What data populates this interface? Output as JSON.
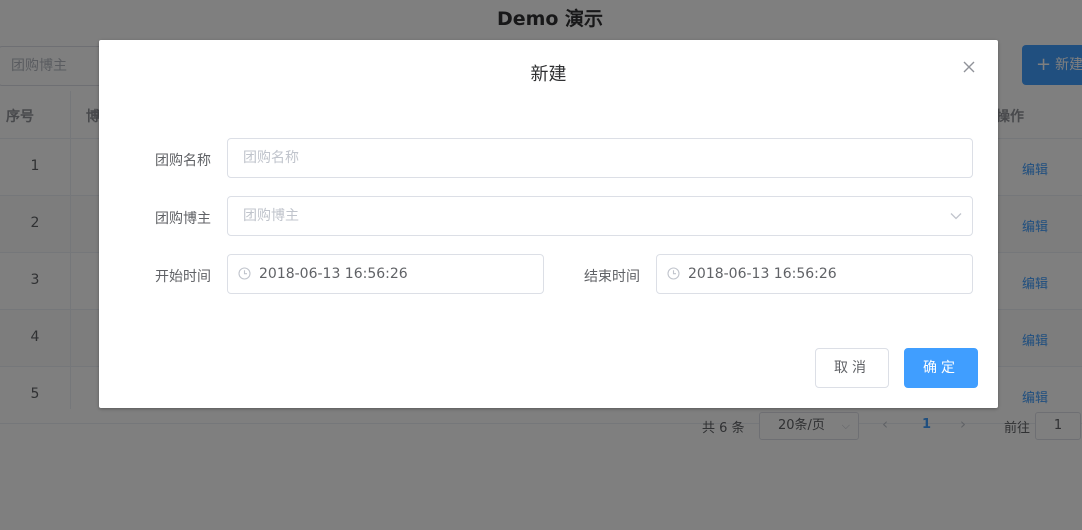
{
  "page": {
    "title": "Demo 演示",
    "search_placeholder": "团购博主",
    "add_button_label": "新建",
    "table": {
      "headers": [
        "序号",
        "博",
        "操作"
      ],
      "rows": [
        {
          "index": "1",
          "action": "编辑"
        },
        {
          "index": "2",
          "action": "编辑"
        },
        {
          "index": "3",
          "action": "编辑"
        },
        {
          "index": "4",
          "action": "编辑"
        },
        {
          "index": "5",
          "action": "编辑"
        }
      ]
    },
    "pagination": {
      "total": "共 6 条",
      "page_size": "20条/页",
      "current_page": "1",
      "goto_label": "前往",
      "goto_value": "1"
    }
  },
  "dialog": {
    "title": "新建",
    "fields": {
      "name": {
        "label": "团购名称",
        "placeholder": "团购名称"
      },
      "blogger": {
        "label": "团购博主",
        "placeholder": "团购博主"
      },
      "start": {
        "label": "开始时间",
        "value": "2018-06-13 16:56:26"
      },
      "end": {
        "label": "结束时间",
        "value": "2018-06-13 16:56:26"
      }
    },
    "cancel_label": "取消",
    "confirm_label": "确定"
  },
  "colors": {
    "primary": "#409eff",
    "mask": "rgba(0,0,0,0.5)",
    "border": "#dcdfe6",
    "placeholder": "#c0c4cc"
  }
}
